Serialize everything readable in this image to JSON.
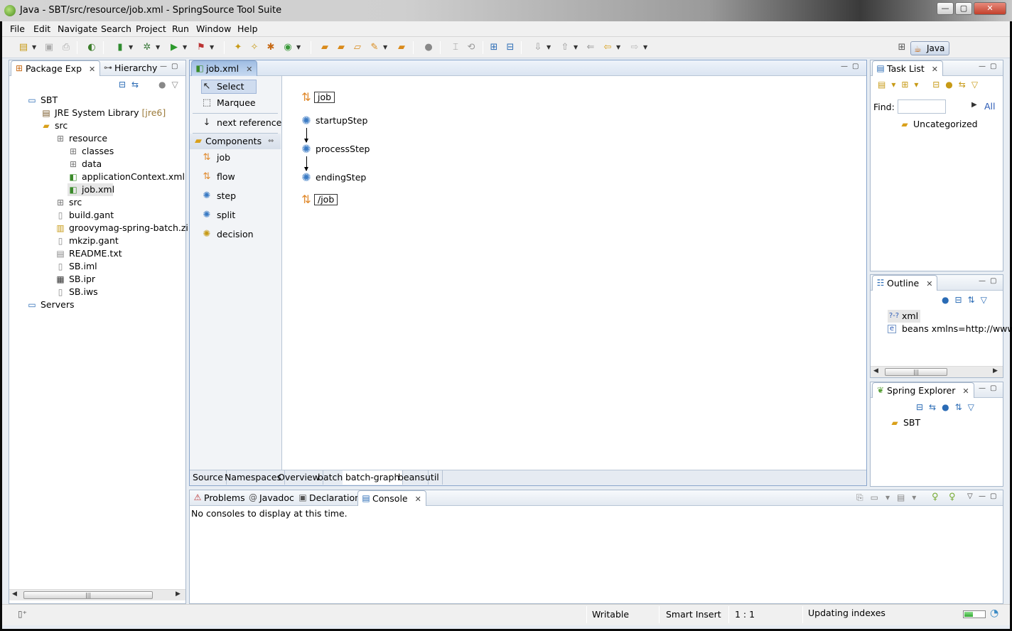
{
  "window": {
    "title": "Java - SBT/src/resource/job.xml - SpringSource Tool Suite",
    "minimize": "—",
    "maximize": "▢",
    "close": "✕"
  },
  "menu": [
    "File",
    "Edit",
    "Navigate",
    "Search",
    "Project",
    "Run",
    "Window",
    "Help"
  ],
  "perspective": {
    "label": "Java"
  },
  "package_explorer": {
    "tabs": [
      "Package Exp",
      "Hierarchy"
    ],
    "tree": [
      {
        "label": "SBT",
        "icon": "project-icon"
      },
      {
        "label": "JRE System Library",
        "decoration": "[jre6]",
        "icon": "library-icon"
      },
      {
        "label": "src",
        "icon": "folder-icon"
      },
      {
        "label": "resource",
        "icon": "package-icon"
      },
      {
        "label": "classes",
        "icon": "package-icon"
      },
      {
        "label": "data",
        "icon": "package-icon"
      },
      {
        "label": "applicationContext.xml",
        "icon": "spring-xml-icon"
      },
      {
        "label": "job.xml",
        "icon": "spring-xml-icon"
      },
      {
        "label": "src",
        "icon": "package-icon"
      },
      {
        "label": "build.gant",
        "icon": "file-icon"
      },
      {
        "label": "groovymag-spring-batch.zip",
        "icon": "zip-icon"
      },
      {
        "label": "mkzip.gant",
        "icon": "file-icon"
      },
      {
        "label": "README.txt",
        "icon": "text-file-icon"
      },
      {
        "label": "SB.iml",
        "icon": "file-icon"
      },
      {
        "label": "SB.ipr",
        "icon": "file-icon"
      },
      {
        "label": "SB.iws",
        "icon": "file-icon"
      },
      {
        "label": "Servers",
        "icon": "project-icon"
      }
    ]
  },
  "editor": {
    "tab": "job.xml",
    "palette": {
      "tools": [
        "Select",
        "Marquee",
        "next reference"
      ],
      "drawer": "Components",
      "items": [
        "job",
        "flow",
        "step",
        "split",
        "decision"
      ]
    },
    "graph": {
      "nodes": [
        "job",
        "startupStep",
        "processStep",
        "endingStep",
        "/job"
      ]
    },
    "bottom_tabs": [
      "Source",
      "Namespaces",
      "Overview",
      "batch",
      "batch-graph",
      "beans",
      "util"
    ],
    "active_bottom_tab": "batch-graph"
  },
  "console": {
    "tabs": [
      "Problems",
      "Javadoc",
      "Declaration",
      "Console"
    ],
    "message": "No consoles to display at this time."
  },
  "task_list": {
    "tab": "Task List",
    "find_label": "Find:",
    "filter_label": "All",
    "category": "Uncategorized"
  },
  "outline": {
    "tab": "Outline",
    "items": [
      {
        "badge": "?-?",
        "label": "xml"
      },
      {
        "badge": "e",
        "label": "beans xmlns=http://www."
      }
    ]
  },
  "spring_explorer": {
    "tab": "Spring Explorer",
    "items": [
      "SBT"
    ]
  },
  "status": {
    "writable": "Writable",
    "insert_mode": "Smart Insert",
    "position": "1 : 1",
    "task": "Updating indexes"
  }
}
